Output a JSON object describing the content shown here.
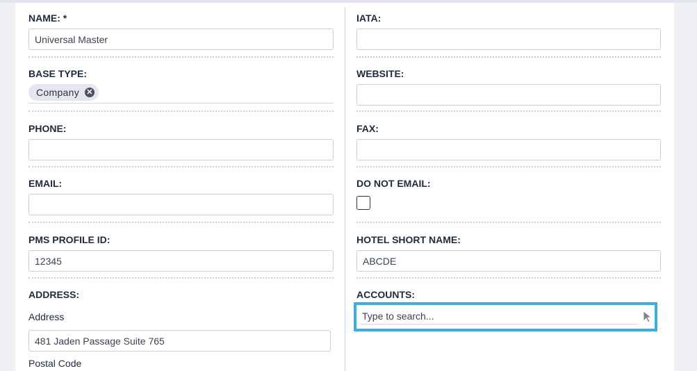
{
  "left": {
    "name": {
      "label": "NAME: *",
      "value": "Universal Master"
    },
    "base_type": {
      "label": "BASE TYPE:",
      "tag": "Company"
    },
    "phone": {
      "label": "PHONE:",
      "value": ""
    },
    "email": {
      "label": "EMAIL:",
      "value": ""
    },
    "pms_profile_id": {
      "label": "PMS PROFILE ID:",
      "value": "12345"
    },
    "address": {
      "label": "ADDRESS:",
      "sub_address_label": "Address",
      "address_value": "481 Jaden Passage Suite 765",
      "sub_postal_label": "Postal Code"
    }
  },
  "right": {
    "iata": {
      "label": "IATA:",
      "value": ""
    },
    "website": {
      "label": "WEBSITE:",
      "value": ""
    },
    "fax": {
      "label": "FAX:",
      "value": ""
    },
    "do_not_email": {
      "label": "DO NOT EMAIL:",
      "checked": false
    },
    "hotel_short_name": {
      "label": "HOTEL SHORT NAME:",
      "value": "ABCDE"
    },
    "accounts": {
      "label": "ACCOUNTS:",
      "placeholder": "Type to search..."
    }
  },
  "colors": {
    "focus_border": "#3aafdf",
    "tag_bg": "#e3e8ef"
  },
  "icons": {
    "tag_remove": "x-circle-icon",
    "cursor": "mouse-pointer-icon"
  }
}
